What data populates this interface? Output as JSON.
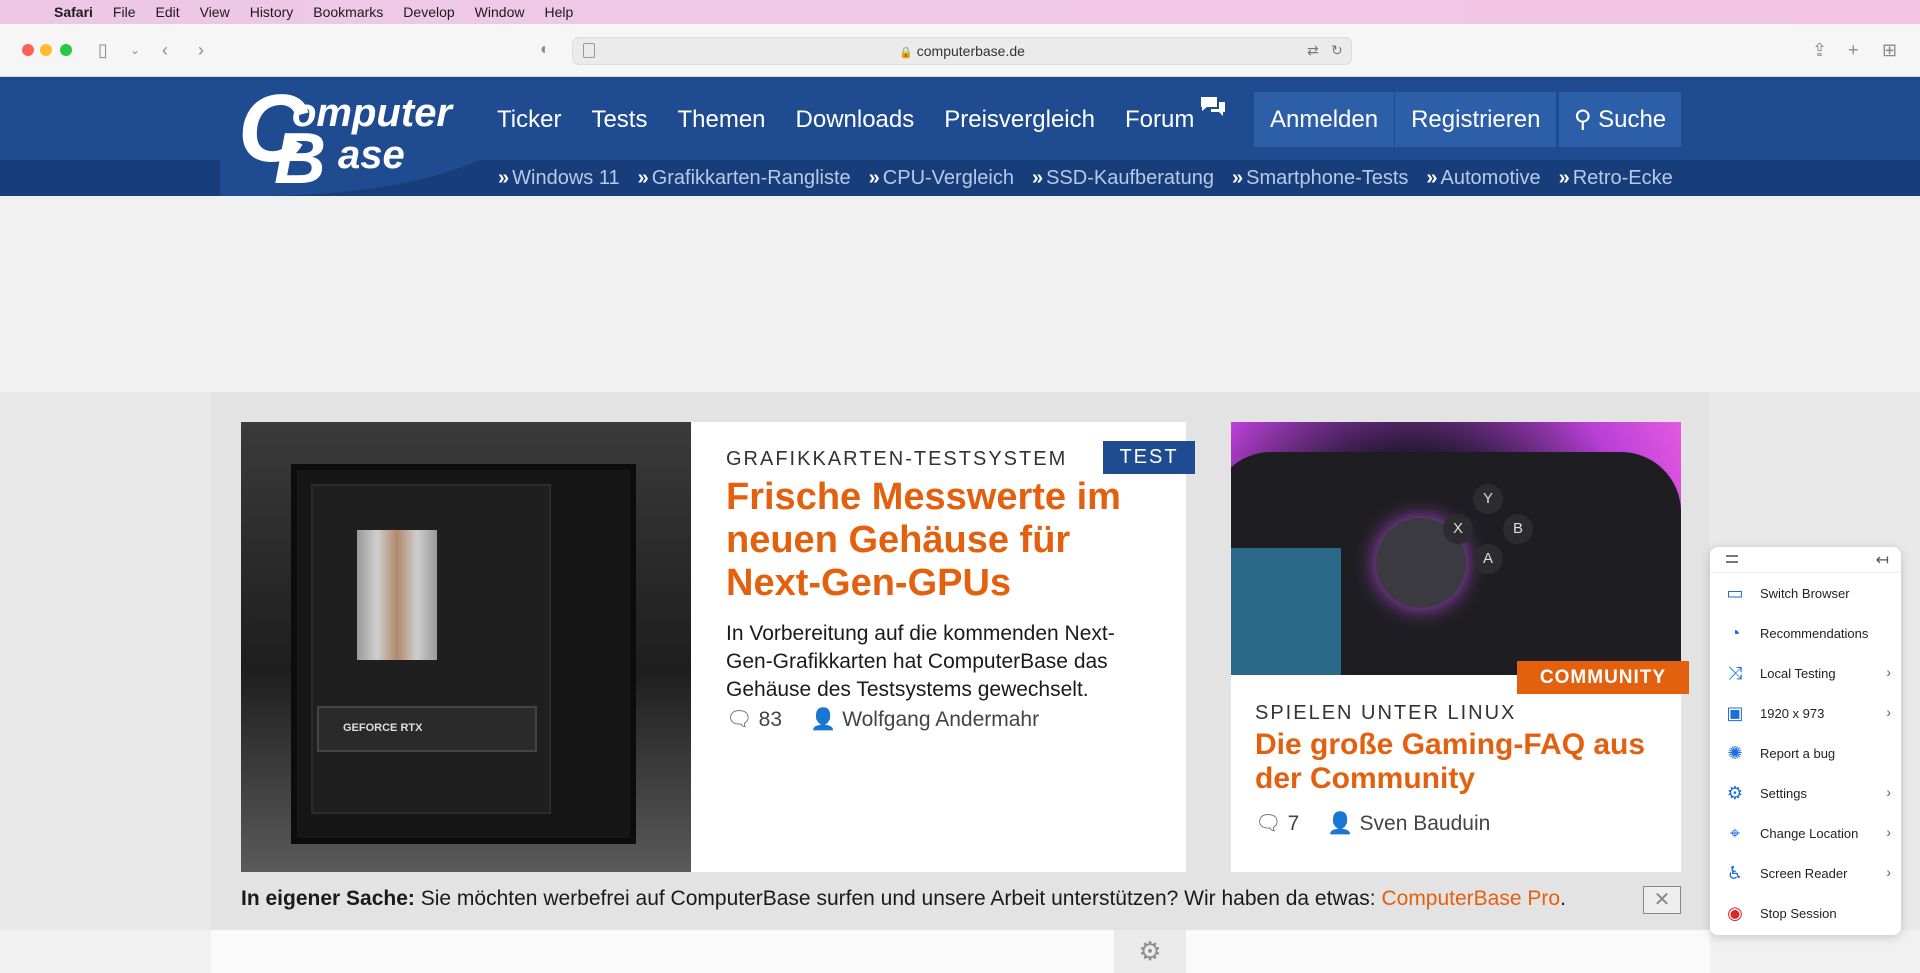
{
  "menubar": {
    "items": [
      "Safari",
      "File",
      "Edit",
      "View",
      "History",
      "Bookmarks",
      "Develop",
      "Window",
      "Help"
    ]
  },
  "browser": {
    "url": "computerbase.de"
  },
  "site": {
    "logo_c": "C",
    "logo_omputer": "omputer",
    "logo_b": "B",
    "logo_ase": "ase",
    "nav": [
      "Ticker",
      "Tests",
      "Themen",
      "Downloads",
      "Preisvergleich",
      "Forum"
    ],
    "auth": {
      "login": "Anmelden",
      "register": "Registrieren"
    },
    "search_label": "Suche",
    "subnav": [
      "Windows 11",
      "Grafikkarten-Rangliste",
      "CPU-Vergleich",
      "SSD-Kaufberatung",
      "Smartphone-Tests",
      "Automotive",
      "Retro-Ecke"
    ]
  },
  "articles": {
    "main": {
      "tag": "TEST",
      "kicker": "GRAFIKKARTEN-TESTSYSTEM",
      "headline": "Frische Messwerte im neuen Gehäuse für Next-Gen-GPUs",
      "teaser": "In Vorbereitung auf die kommenden Next-Gen-Grafikkarten hat ComputerBase das Gehäuse des Testsystems gewechselt.",
      "comments": "83",
      "author": "Wolfgang Andermahr",
      "image_caption": "GEFORCE RTX"
    },
    "side": {
      "tag": "COMMUNITY",
      "kicker": "SPIELEN UNTER LINUX",
      "headline": "Die große Gaming-FAQ aus der Community",
      "comments": "7",
      "author": "Sven Bauduin"
    }
  },
  "promo": {
    "bold": "In eigener Sache:",
    "text": "Sie möchten werbefrei auf ComputerBase surfen und unsere Arbeit unterstützen? Wir haben da etwas:",
    "link": "ComputerBase Pro",
    "end": "."
  },
  "panel": {
    "items": [
      {
        "label": "Switch Browser",
        "icon": "devices-icon"
      },
      {
        "label": "Recommendations",
        "icon": "recommendations-icon"
      },
      {
        "label": "Local Testing",
        "icon": "shuffle-icon"
      },
      {
        "label": "1920 x 973",
        "icon": "resolution-icon"
      },
      {
        "label": "Report a bug",
        "icon": "bug-icon"
      },
      {
        "label": "Settings",
        "icon": "gear-icon"
      },
      {
        "label": "Change Location",
        "icon": "location-pin-icon"
      },
      {
        "label": "Screen Reader",
        "icon": "accessibility-icon"
      },
      {
        "label": "Stop Session",
        "icon": "stop-icon"
      }
    ]
  },
  "colors": {
    "brand_blue": "#1f4c91",
    "accent_orange": "#e3600f",
    "panel_icon": "#1b6fd8",
    "stop_red": "#d42b2b"
  }
}
